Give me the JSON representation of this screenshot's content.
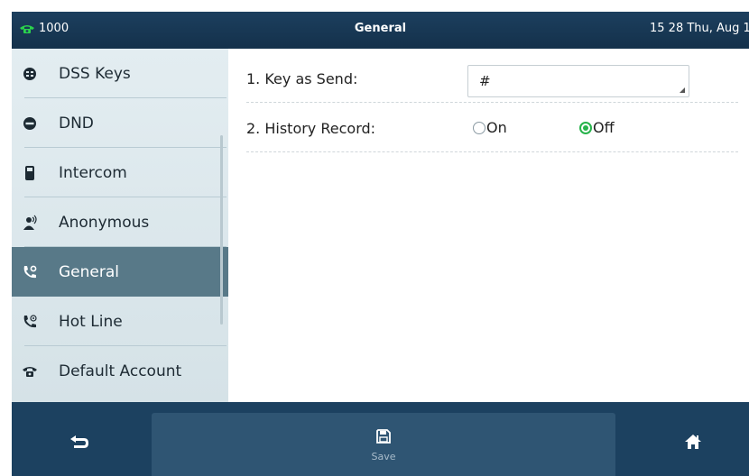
{
  "status_bar": {
    "account": "1000",
    "title": "General",
    "datetime": "15 28 Thu, Aug 1"
  },
  "sidebar": {
    "items": [
      {
        "label": "DSS Keys",
        "icon": "dss-keys-icon",
        "selected": false
      },
      {
        "label": "DND",
        "icon": "dnd-icon",
        "selected": false
      },
      {
        "label": "Intercom",
        "icon": "intercom-icon",
        "selected": false
      },
      {
        "label": "Anonymous",
        "icon": "anonymous-icon",
        "selected": false
      },
      {
        "label": "General",
        "icon": "general-icon",
        "selected": true
      },
      {
        "label": "Hot Line",
        "icon": "hot-line-icon",
        "selected": false
      },
      {
        "label": "Default Account",
        "icon": "default-account-icon",
        "selected": false
      }
    ]
  },
  "settings": {
    "key_as_send": {
      "label": "1. Key as Send:",
      "value": "#"
    },
    "history_record": {
      "label": "2. History Record:",
      "options": [
        {
          "label": "On",
          "checked": false
        },
        {
          "label": "Off",
          "checked": true
        }
      ]
    }
  },
  "bottom_bar": {
    "back": {
      "icon": "back-icon"
    },
    "save": {
      "icon": "save-icon",
      "label": "Save"
    },
    "home": {
      "icon": "home-icon"
    }
  },
  "colors": {
    "status_bar": "#1c3f5e",
    "sidebar_bg": "#dde8ec",
    "sidebar_selected": "#587988",
    "radio_checked": "#27b34b",
    "bottom_bar": "#1c4160"
  }
}
